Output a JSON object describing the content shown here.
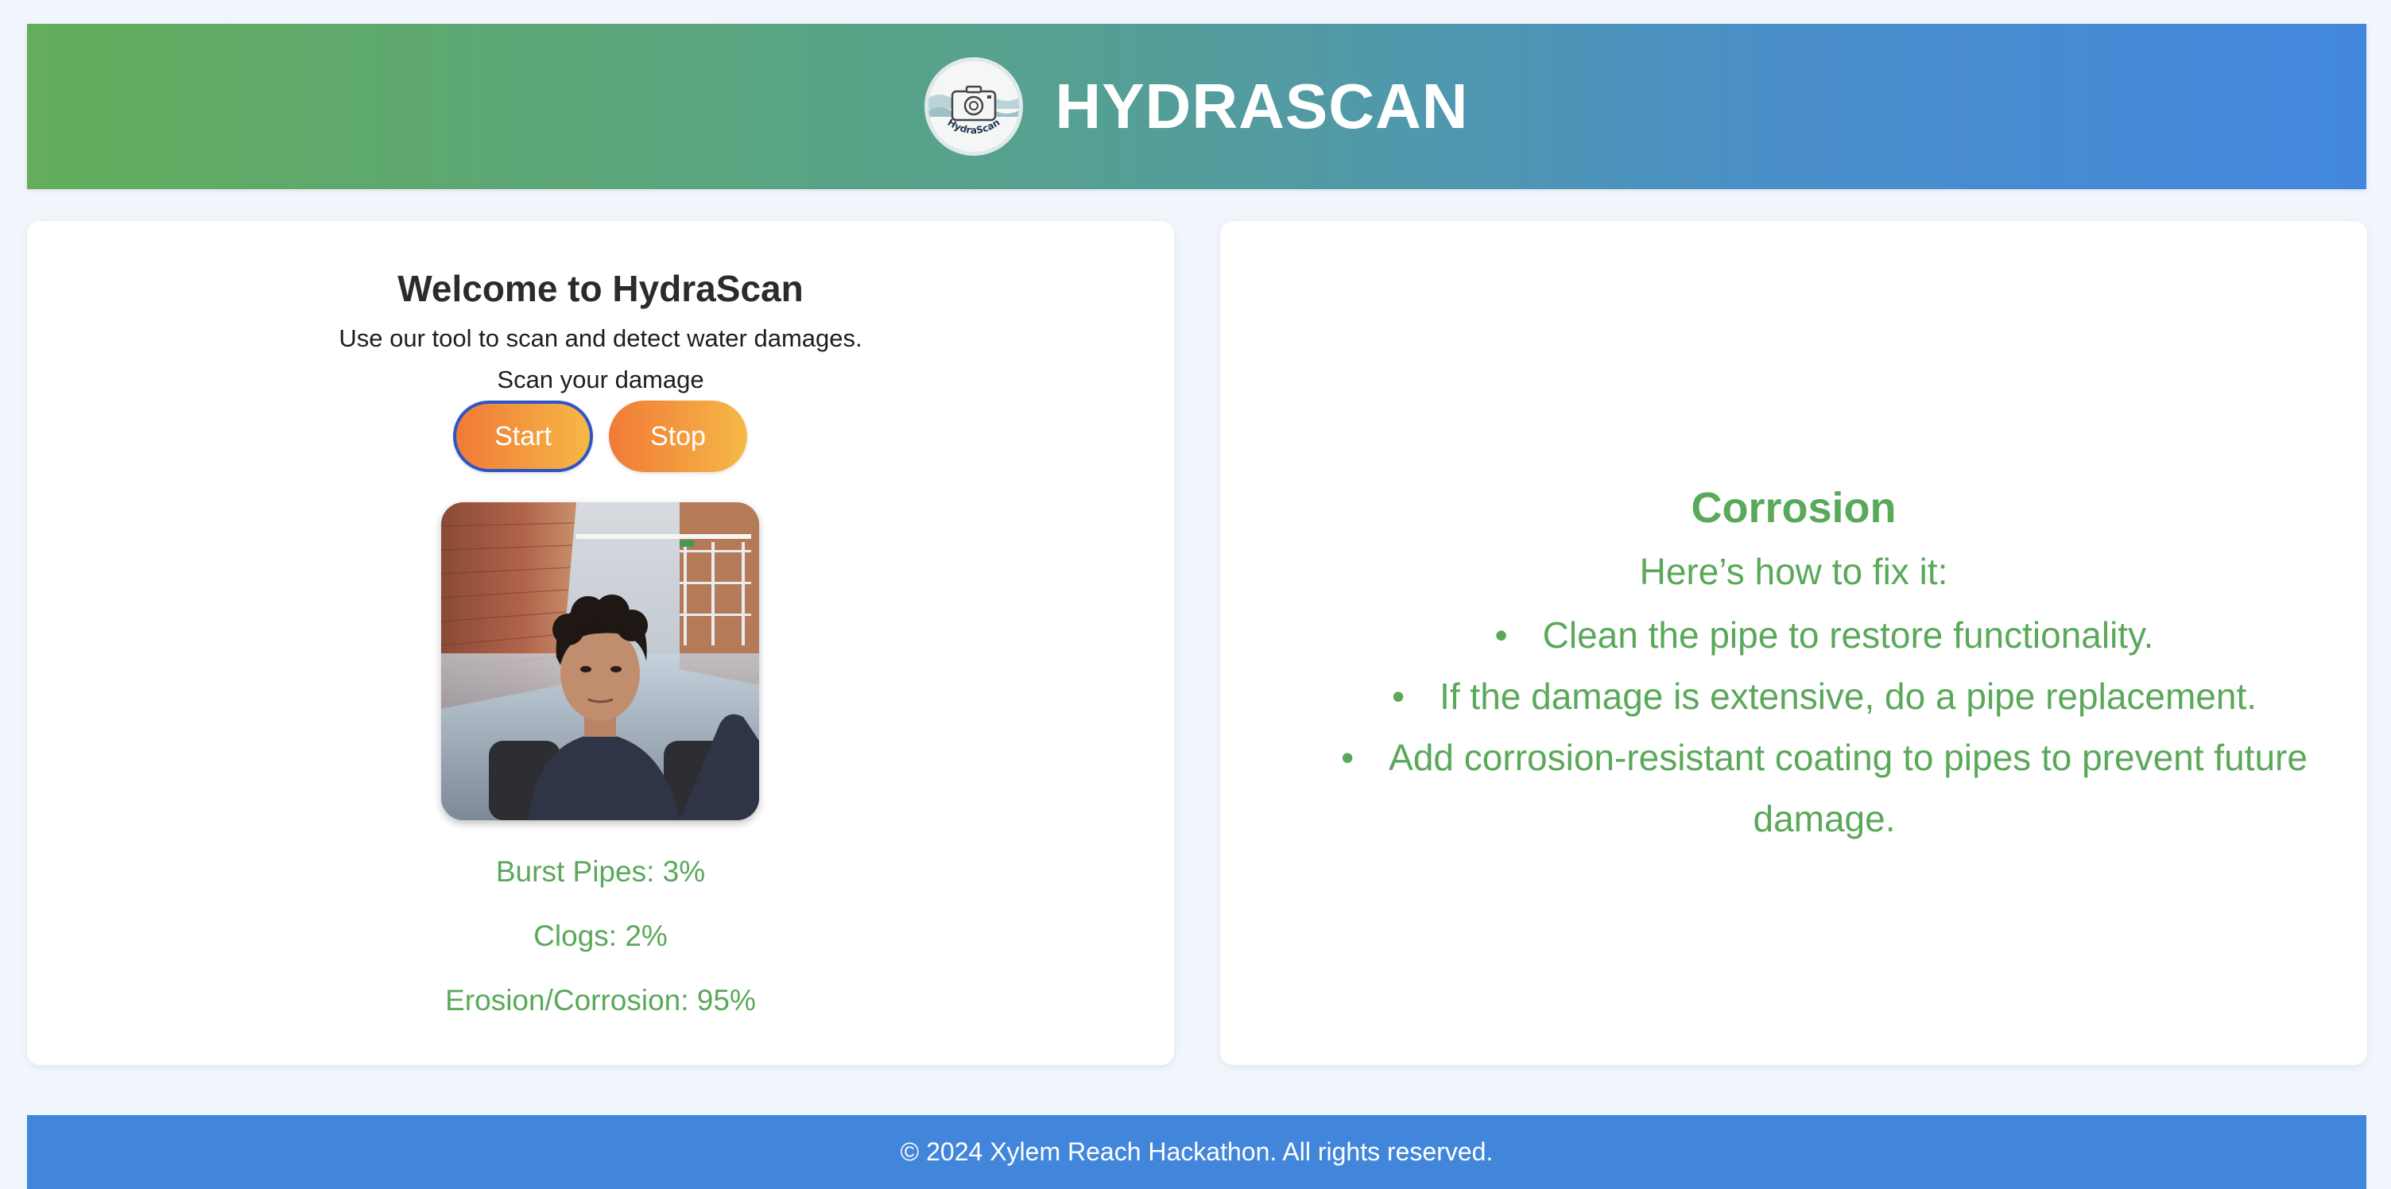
{
  "header": {
    "brand": "HYDRASCAN",
    "logo_text": "HydraScan",
    "logo_icon": "camera-icon"
  },
  "left_panel": {
    "title": "Welcome to HydraScan",
    "subtitle": "Use our tool to scan and detect water damages.",
    "scan_label": "Scan your damage",
    "buttons": {
      "start": "Start",
      "stop": "Stop"
    },
    "video_feed": "webcam-feed",
    "metrics": [
      {
        "label": "Burst Pipes: 3%",
        "value": 3
      },
      {
        "label": "Clogs: 2%",
        "value": 2
      },
      {
        "label": "Erosion/Corrosion: 95%",
        "value": 95
      }
    ]
  },
  "right_panel": {
    "title": "Corrosion",
    "subtitle": "Here’s how to fix it:",
    "bullet": "•",
    "fixes": [
      "Clean the pipe to restore functionality.",
      "If the damage is extensive, do a pipe replacement.",
      "Add corrosion-resistant coating to pipes to prevent future damage."
    ]
  },
  "footer": {
    "text": "© 2024 Xylem Reach Hackathon. All rights reserved."
  },
  "colors": {
    "header_gradient_start": "#63ad5c",
    "header_gradient_end": "#4287dd",
    "accent_green": "#5aa85a",
    "button_gradient_start": "#f07a36",
    "button_gradient_end": "#f6b847",
    "footer_blue": "#4286dc"
  }
}
